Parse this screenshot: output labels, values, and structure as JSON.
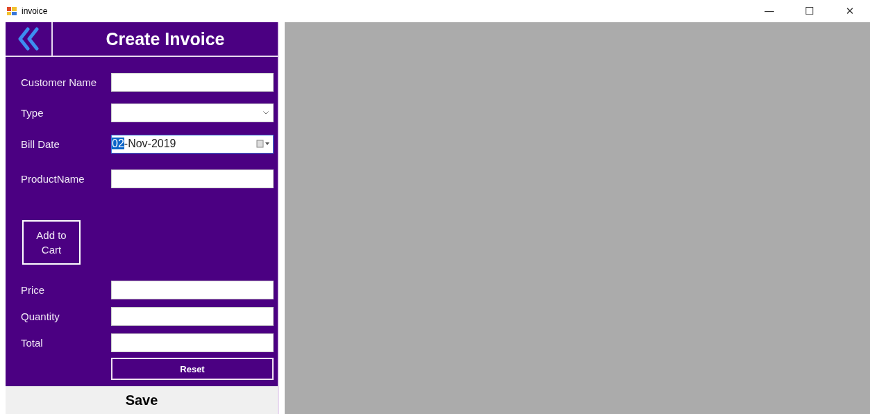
{
  "window": {
    "title": "invoice",
    "controls": [
      "—",
      "☐",
      "✕"
    ]
  },
  "header": {
    "title": "Create Invoice"
  },
  "fields": [
    {
      "label": "Customer Name",
      "kind": "text"
    },
    {
      "label": "Type",
      "kind": "combo"
    },
    {
      "label": "Bill Date",
      "kind": "date",
      "focused": true,
      "value_parts": [
        {
          "text": "02",
          "selected": true
        },
        {
          "text": "-Nov-2019",
          "selected": false
        }
      ]
    },
    {
      "label": "ProductName",
      "kind": "text"
    }
  ],
  "add_button": "Add to Cart",
  "totals": [
    {
      "label": "Price",
      "kind": "text"
    },
    {
      "label": "Quantity",
      "kind": "text"
    },
    {
      "label": "Total",
      "kind": "text"
    }
  ],
  "reset_button": "Reset",
  "save_button": "Save"
}
